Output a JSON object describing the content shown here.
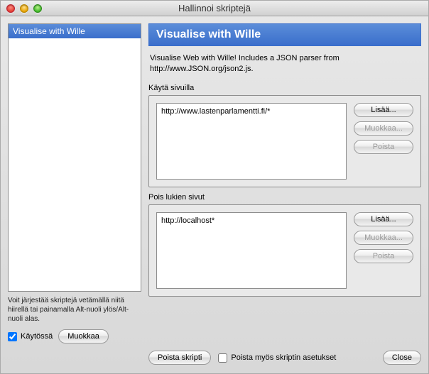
{
  "window": {
    "title": "Hallinnoi skriptejä"
  },
  "left": {
    "scripts": [
      {
        "name": "Visualise with Wille"
      }
    ],
    "hint": "Voit järjestää skriptejä vetämällä niitä hiirellä tai painamalla Alt-nuoli ylös/Alt-nuoli alas.",
    "in_use_label": "Käytössä",
    "in_use_checked": true,
    "edit_label": "Muokkaa"
  },
  "script": {
    "title": "Visualise with Wille",
    "description": "Visualise Web with Wille! Includes a JSON parser from http://www.JSON.org/json2.js."
  },
  "include": {
    "label": "Käytä sivuilla",
    "items": [
      "http://www.lastenparlamentti.fi/*"
    ],
    "add_label": "Lisää...",
    "edit_label": "Muokkaa...",
    "remove_label": "Poista"
  },
  "exclude": {
    "label": "Pois lukien sivut",
    "items": [
      "http://localhost*"
    ],
    "add_label": "Lisää...",
    "edit_label": "Muokkaa...",
    "remove_label": "Poista"
  },
  "bottom": {
    "remove_script_label": "Poista skripti",
    "remove_settings_label": "Poista myös skriptin asetukset",
    "remove_settings_checked": false,
    "close_label": "Close"
  }
}
